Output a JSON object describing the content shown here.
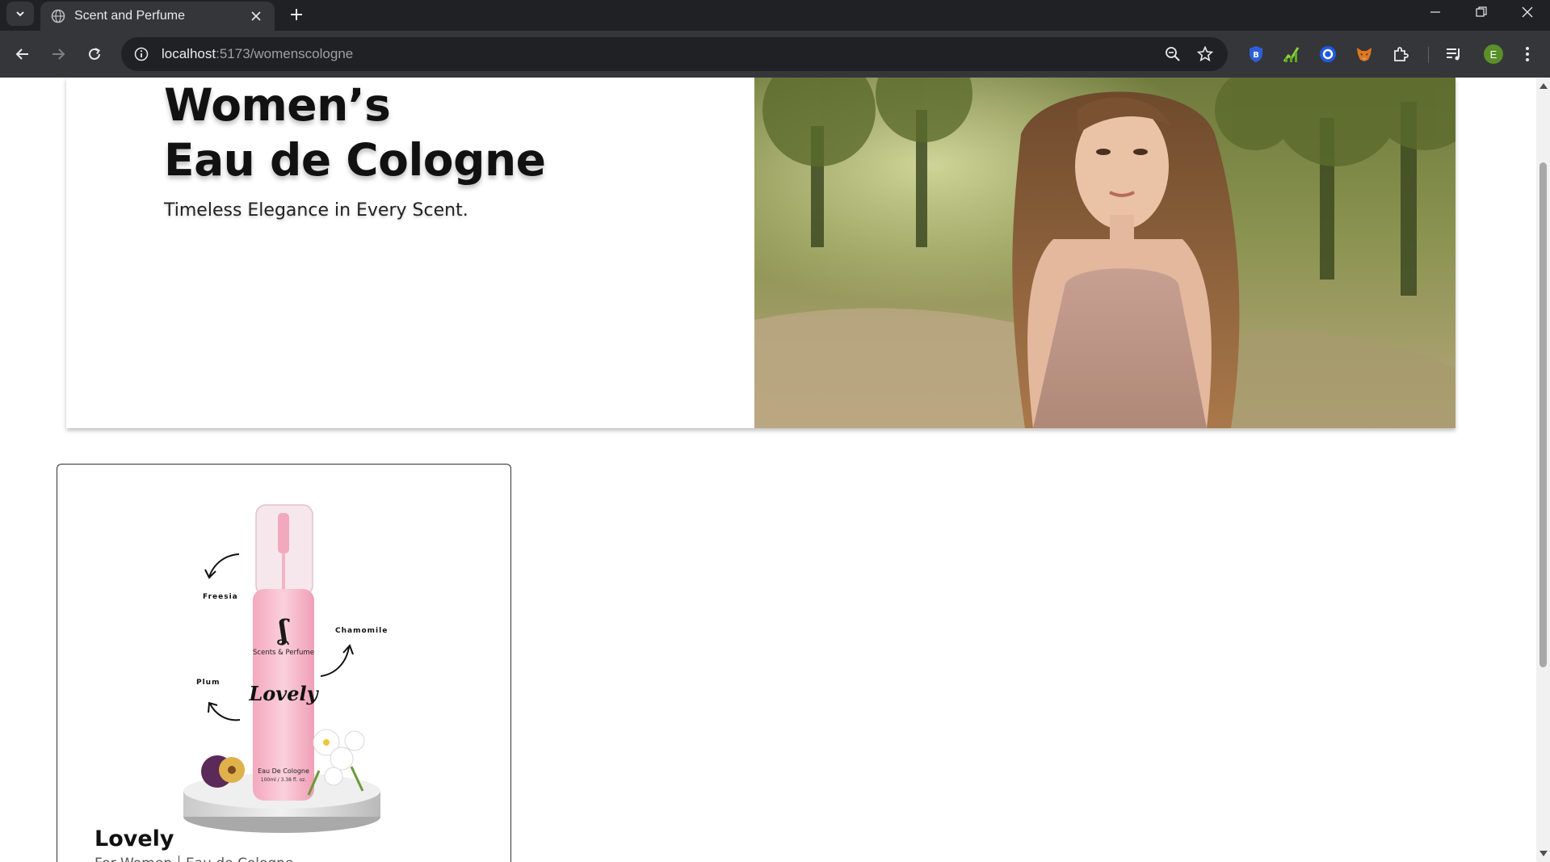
{
  "browser": {
    "tab_title": "Scent and Perfume",
    "url_host": "localhost",
    "url_path": ":5173/womenscologne",
    "profile_initial": "E"
  },
  "hero": {
    "title_line1": "Women’s",
    "title_line2": "Eau de Cologne",
    "subtitle": "Timeless Elegance in Every Scent."
  },
  "product": {
    "name": "Lovely",
    "audience": "For Women",
    "category": "Eau de Cologne",
    "image_labels": {
      "note1": "Freesia",
      "note2": "Chamomile",
      "note3": "Plum",
      "brand": "Scents & Perfume",
      "script_name": "Lovely",
      "bottle_type": "Eau De Cologne",
      "volume": "100ml / 3.38 fl. oz."
    }
  },
  "colors": {
    "chrome_dark": "#202124",
    "chrome_toolbar": "#35363a",
    "bottle_pink": "#f5b7c8",
    "text_dark": "#111111"
  }
}
